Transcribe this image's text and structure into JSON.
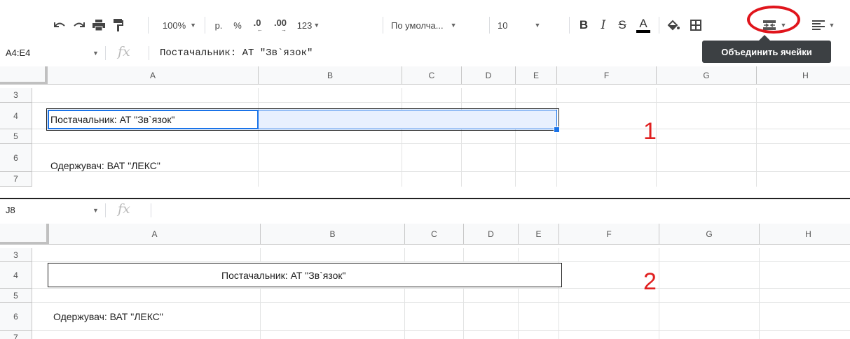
{
  "toolbar": {
    "zoom": "100%",
    "currency": "р.",
    "percent": "%",
    "decrease_decimals": ".0",
    "increase_decimals": ".00",
    "more_formats": "123",
    "font": "По умолча...",
    "font_size": "10",
    "bold": "B",
    "italic": "I",
    "strikethrough": "S",
    "text_color": "A",
    "merge_tooltip": "Объединить ячейки",
    "icons": [
      "undo-icon",
      "redo-icon",
      "print-icon",
      "paint-format-icon",
      "fill-color-icon",
      "borders-icon",
      "merge-cells-icon",
      "align-icon"
    ],
    "highlight_color": "#e0151c"
  },
  "sheet1": {
    "name_box": "A4:E4",
    "formula": "Постачальник: АТ \"Зв`язок\"",
    "columns": [
      "A",
      "B",
      "C",
      "D",
      "E",
      "F",
      "G",
      "H"
    ],
    "rows": [
      "3",
      "4",
      "5",
      "6",
      "7"
    ],
    "cells": {
      "a4": "Постачальник: АТ \"Зв`язок\"",
      "a6": "Одержувач: ВАТ \"ЛЕКС\""
    },
    "annotation": "1",
    "selection_color": "#1a73e8"
  },
  "sheet2": {
    "name_box": "J8",
    "formula": "",
    "columns": [
      "A",
      "B",
      "C",
      "D",
      "E",
      "F",
      "G",
      "H"
    ],
    "rows": [
      "3",
      "4",
      "5",
      "6",
      "7"
    ],
    "cells": {
      "merged_a4_e4": "Постачальник: АТ \"Зв`язок\"",
      "a6": "Одержувач: ВАТ \"ЛЕКС\""
    },
    "annotation": "2"
  }
}
